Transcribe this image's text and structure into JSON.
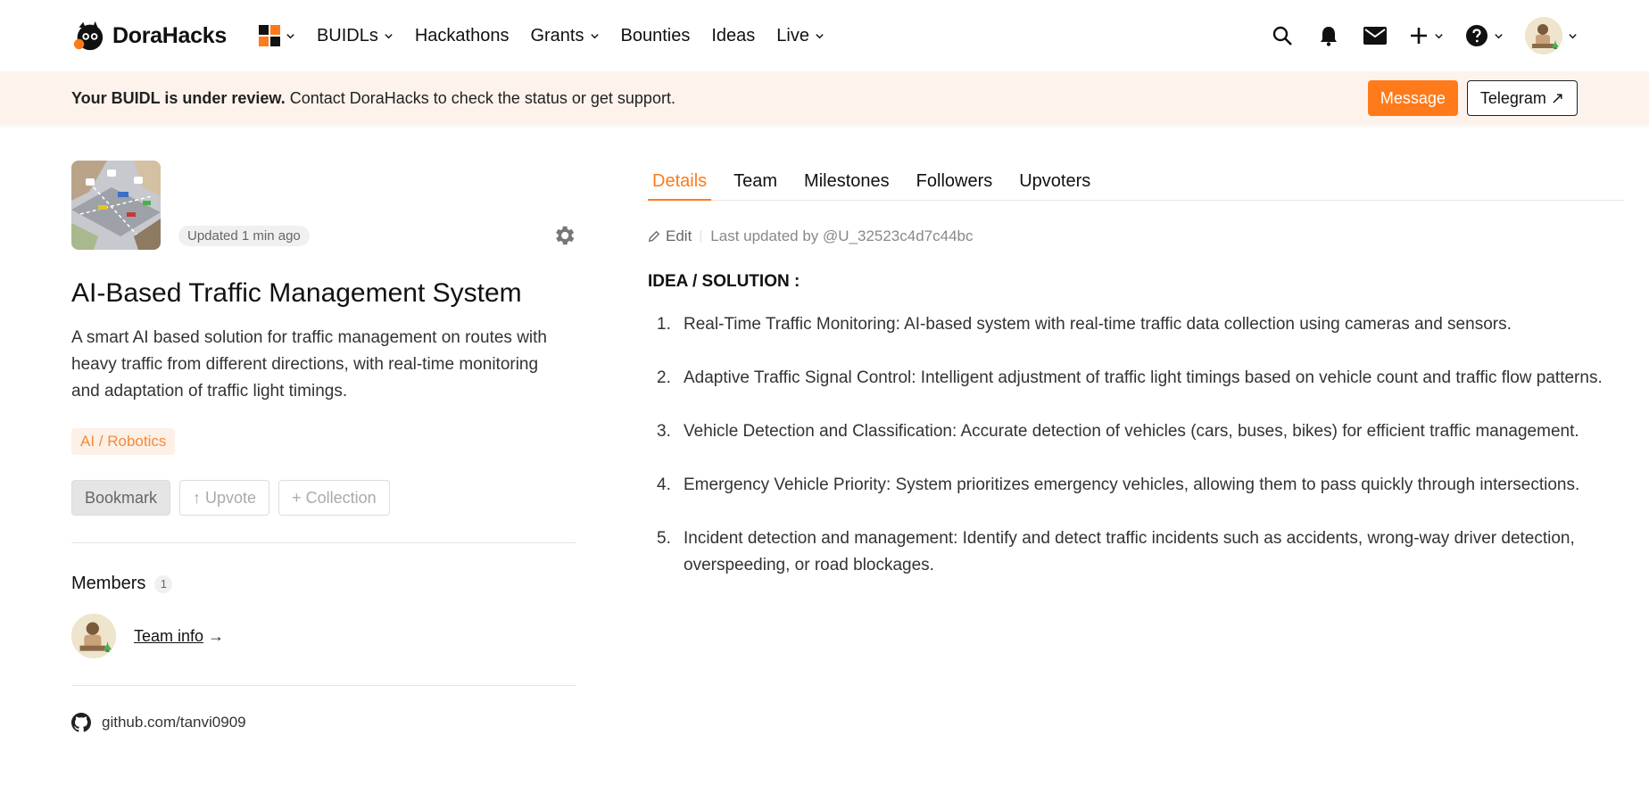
{
  "nav": {
    "brand": "DoraHacks",
    "items": [
      "BUIDLs",
      "Hackathons",
      "Grants",
      "Bounties",
      "Ideas",
      "Live"
    ]
  },
  "banner": {
    "bold": "Your BUIDL is under review.",
    "text": "Contact DoraHacks to check the status or get support.",
    "message_button": "Message",
    "telegram_button": "Telegram ↗"
  },
  "project": {
    "updated": "Updated 1 min ago",
    "title": "AI-Based Traffic Management System",
    "description": "A smart AI based solution for traffic management on routes with heavy traffic from different directions, with real-time monitoring and adaptation of traffic light timings.",
    "tag": "AI / Robotics",
    "bookmark": "Bookmark",
    "upvote": "↑ Upvote",
    "collection": "+ Collection"
  },
  "members": {
    "label": "Members",
    "count": "1",
    "team_info": "Team info",
    "arrow": "→"
  },
  "github": "github.com/tanvi0909",
  "tabs": [
    "Details",
    "Team",
    "Milestones",
    "Followers",
    "Upvoters"
  ],
  "details": {
    "edit": "Edit",
    "last_updated": "Last updated by @U_32523c4d7c44bc",
    "section_title": "IDEA / SOLUTION :",
    "items": [
      {
        "num": "1.",
        "text": "Real-Time Traffic Monitoring: AI-based system with real-time traffic data collection using cameras and sensors."
      },
      {
        "num": "2.",
        "text": "Adaptive Traffic Signal Control: Intelligent adjustment of traffic light timings based on vehicle count and traffic flow patterns."
      },
      {
        "num": "3.",
        "text": "Vehicle Detection and Classification: Accurate detection of vehicles (cars, buses, bikes) for efficient traffic management."
      },
      {
        "num": "4.",
        "text": "Emergency Vehicle Priority: System prioritizes emergency vehicles, allowing them to pass quickly through intersections."
      },
      {
        "num": "5.",
        "text": "Incident detection and management: Identify and detect traffic incidents such as accidents, wrong-way driver detection, overspeeding, or road blockages."
      }
    ]
  },
  "colors": {
    "accent": "#ff7a1a",
    "banner_bg": "#fdf3ec",
    "tag_bg": "#fdf0e7",
    "tag_text": "#f58a3a"
  },
  "icons": [
    "dorahacks-logo-icon",
    "apps-grid-icon",
    "chevron-down-icon",
    "search-icon",
    "bell-icon",
    "mail-icon",
    "plus-icon",
    "help-icon",
    "gear-icon",
    "pencil-icon",
    "github-icon"
  ]
}
